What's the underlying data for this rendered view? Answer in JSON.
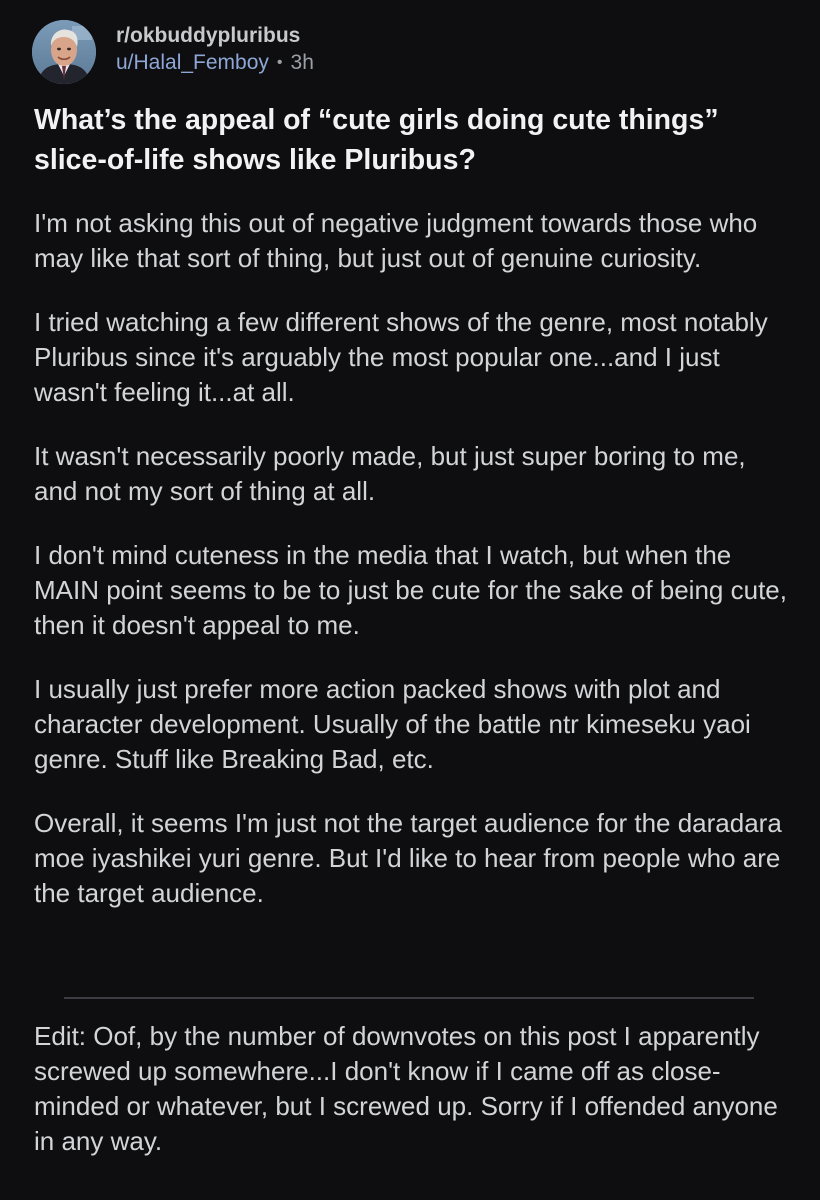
{
  "header": {
    "subreddit": "r/okbuddypluribus",
    "username": "u/Halal_Femboy",
    "separator": "•",
    "age": "3h",
    "avatar_icon": "user-avatar-photo"
  },
  "post": {
    "title": "What’s the appeal of “cute girls doing cute things” slice-of-life shows like Pluribus?",
    "paragraphs": [
      "I'm not asking this out of negative judgment towards those who may like that sort of thing, but just out of genuine curiosity.",
      "I tried watching a few different shows of the genre, most notably Pluribus since it's arguably the most popular one...and I just wasn't feeling it...at all.",
      "It wasn't necessarily poorly made, but just super boring to me, and not my sort of thing at all.",
      "I don't mind cuteness in the media that I watch, but when the MAIN point seems to be to just be cute for the sake of being cute, then it doesn't appeal to me.",
      "I usually just prefer more action packed shows with plot and character development. Usually of the battle ntr kimeseku yaoi genre. Stuff like Breaking Bad, etc.",
      "Overall, it seems I'm just not the target audience for the daradara moe iyashikei yuri genre. But I'd like to hear from people who are the target audience."
    ],
    "edit": "Edit: Oof, by the number of downvotes on this post I apparently screwed up somewhere...I don't know if I came off as close-minded or whatever, but I screwed up. Sorry if I offended anyone in any way."
  },
  "colors": {
    "background": "#0e0e10",
    "text": "#d2d4d8",
    "title": "#f2f2f4",
    "username": "#8ea7d6",
    "muted": "#9aa0a6",
    "divider": "#3c3d42"
  }
}
